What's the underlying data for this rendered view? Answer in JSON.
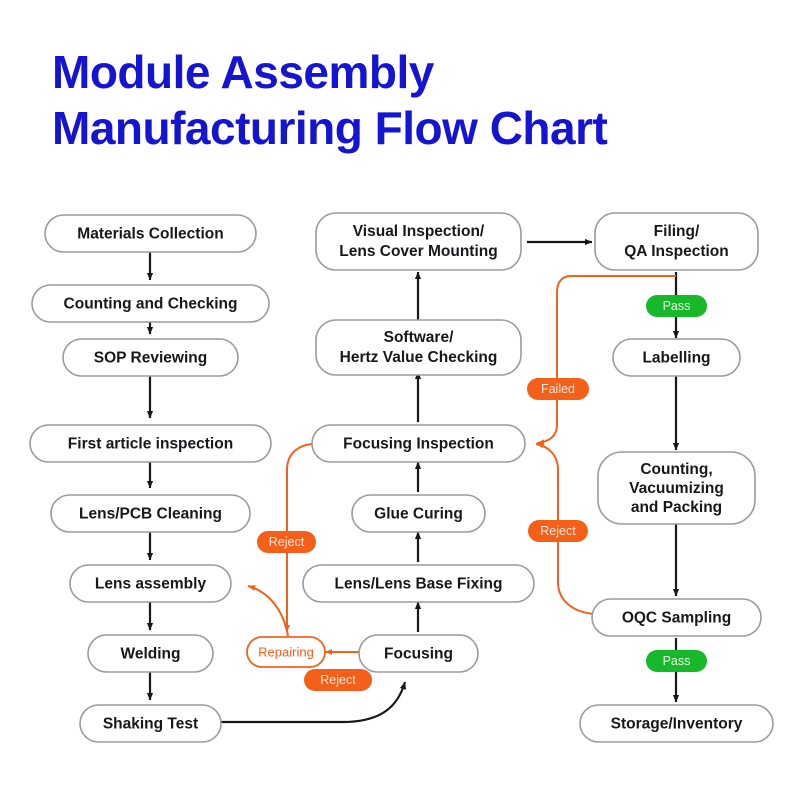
{
  "title": {
    "line1": "Module Assembly",
    "line2": "Manufacturing Flow Chart",
    "color": "#1414d2"
  },
  "colors": {
    "node_border": "#9b9b9b",
    "node_fill": "#ffffff",
    "text": "#16181c",
    "arrow": "#16181c",
    "reject_orange": "#f4601a",
    "pass_green": "#17b82a",
    "background": "#ffffff"
  },
  "nodes": {
    "materials_collection": "Materials Collection",
    "counting_and_checking": "Counting and Checking",
    "sop_reviewing": "SOP Reviewing",
    "first_article_inspection": "First article inspection",
    "lens_pcb_cleaning": "Lens/PCB Cleaning",
    "lens_assembly": "Lens assembly",
    "welding": "Welding",
    "shaking_test": "Shaking Test",
    "focusing": "Focusing",
    "lens_lens_base_fixing": "Lens/Lens Base Fixing",
    "glue_curing": "Glue Curing",
    "focusing_inspection": "Focusing Inspection",
    "software_hertz_line1": "Software/",
    "software_hertz_line2": "Hertz Value Checking",
    "visual_inspection_line1": "Visual Inspection/",
    "visual_inspection_line2": "Lens Cover Mounting",
    "filing_qa_line1": "Filing/",
    "filing_qa_line2": "QA Inspection",
    "labelling": "Labelling",
    "counting_vacuum_line1": "Counting,",
    "counting_vacuum_line2": "Vacuumizing",
    "counting_vacuum_line3": "and Packing",
    "oqc_sampling": "OQC Sampling",
    "storage_inventory": "Storage/Inventory",
    "repairing": "Repairing"
  },
  "badges": {
    "reject_focusing": "Reject",
    "reject_focusing_inspection": "Reject",
    "failed_filing_qa": "Failed",
    "reject_oqc": "Reject",
    "pass_filing_qa": "Pass",
    "pass_oqc": "Pass"
  }
}
